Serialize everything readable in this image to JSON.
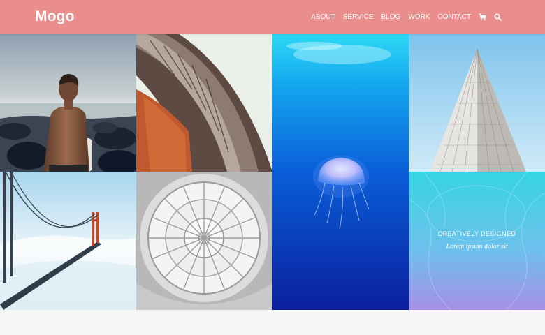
{
  "header": {
    "logo": "Mogo",
    "nav": [
      "ABOUT",
      "SERVICE",
      "BLOG",
      "WORK",
      "CONTACT"
    ],
    "icons": [
      "cart-icon",
      "search-icon"
    ]
  },
  "gallery": {
    "tiles": [
      {
        "name": "man-at-shore-photo"
      },
      {
        "name": "curved-architecture-photo"
      },
      {
        "name": "jellyfish-underwater-photo"
      },
      {
        "name": "skyscraper-photo"
      },
      {
        "name": "bridge-in-fog-photo"
      },
      {
        "name": "dome-ceiling-photo"
      },
      {
        "name": "creative-overlay-tile"
      }
    ],
    "overlay": {
      "title": "CREATIVELY DESIGNED",
      "subtitle": "Lorem ipsum dolor sit"
    }
  },
  "colors": {
    "header_bg": "#e98e8c",
    "overlay_gradient_top": "#36d4e4",
    "overlay_gradient_bottom": "#a58fe6"
  }
}
